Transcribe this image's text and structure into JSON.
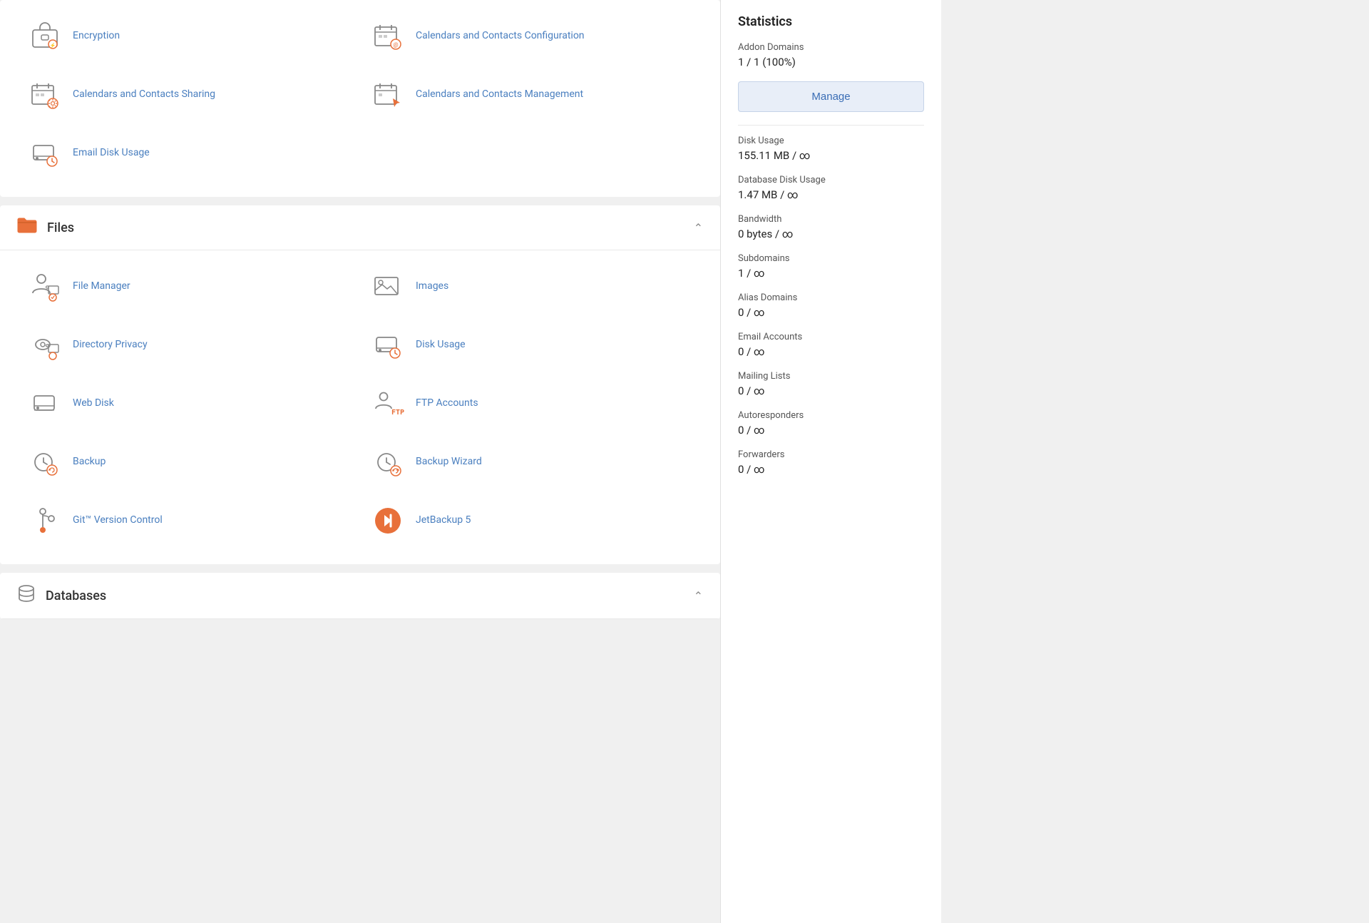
{
  "sections": [
    {
      "id": "email-section-top",
      "title": null,
      "icon": null,
      "items": [
        {
          "id": "encryption",
          "label": "Encryption",
          "icon": "briefcase"
        },
        {
          "id": "calendars-contacts-config",
          "label": "Calendars and Contacts Configuration",
          "icon": "calendar-at"
        },
        {
          "id": "calendars-contacts-sharing",
          "label": "Calendars and Contacts Sharing",
          "icon": "calendar-settings"
        },
        {
          "id": "calendars-contacts-management",
          "label": "Calendars and Contacts Management",
          "icon": "calendar-cursor"
        },
        {
          "id": "email-disk-usage",
          "label": "Email Disk Usage",
          "icon": "disk-clock"
        }
      ]
    },
    {
      "id": "files",
      "title": "Files",
      "icon": "folder",
      "items": [
        {
          "id": "file-manager",
          "label": "File Manager",
          "icon": "person-folder"
        },
        {
          "id": "images",
          "label": "Images",
          "icon": "image"
        },
        {
          "id": "directory-privacy",
          "label": "Directory Privacy",
          "icon": "eye-folder"
        },
        {
          "id": "disk-usage",
          "label": "Disk Usage",
          "icon": "disk-clock2"
        },
        {
          "id": "web-disk",
          "label": "Web Disk",
          "icon": "disk"
        },
        {
          "id": "ftp-accounts",
          "label": "FTP Accounts",
          "icon": "person-ftp"
        },
        {
          "id": "backup",
          "label": "Backup",
          "icon": "clock-refresh"
        },
        {
          "id": "backup-wizard",
          "label": "Backup Wizard",
          "icon": "clock-refresh-plus"
        },
        {
          "id": "git-version-control",
          "label": "Git™ Version Control",
          "icon": "git"
        },
        {
          "id": "jetbackup5",
          "label": "JetBackup 5",
          "icon": "jetbackup"
        }
      ]
    },
    {
      "id": "databases",
      "title": "Databases",
      "icon": "database",
      "items": []
    }
  ],
  "statistics": {
    "title": "Statistics",
    "manage_button": "Manage",
    "stats": [
      {
        "id": "addon-domains",
        "label": "Addon Domains",
        "value": "1 / 1  (100%)"
      },
      {
        "id": "disk-usage",
        "label": "Disk Usage",
        "value": "155.11 MB / ∞"
      },
      {
        "id": "database-disk-usage",
        "label": "Database Disk Usage",
        "value": "1.47 MB / ∞"
      },
      {
        "id": "bandwidth",
        "label": "Bandwidth",
        "value": "0 bytes / ∞"
      },
      {
        "id": "subdomains",
        "label": "Subdomains",
        "value": "1 / ∞"
      },
      {
        "id": "alias-domains",
        "label": "Alias Domains",
        "value": "0 / ∞"
      },
      {
        "id": "email-accounts",
        "label": "Email Accounts",
        "value": "0 / ∞"
      },
      {
        "id": "mailing-lists",
        "label": "Mailing Lists",
        "value": "0 / ∞"
      },
      {
        "id": "autoresponders",
        "label": "Autoresponders",
        "value": "0 / ∞"
      },
      {
        "id": "forwarders",
        "label": "Forwarders",
        "value": "0 / ∞"
      }
    ]
  }
}
